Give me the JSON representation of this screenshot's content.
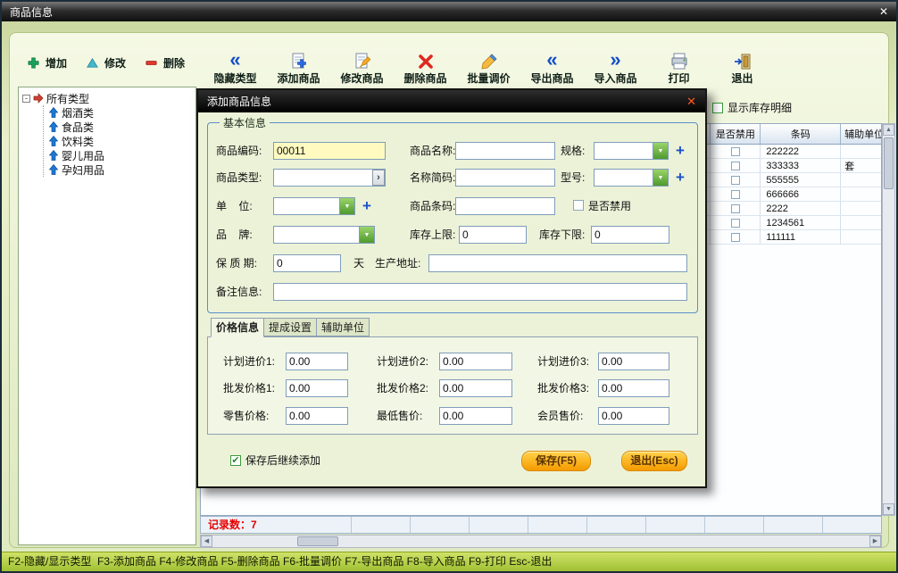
{
  "window": {
    "title": "商品信息",
    "close_glyph": "✕"
  },
  "toolbar": {
    "small": [
      {
        "label": "增加"
      },
      {
        "label": "修改"
      },
      {
        "label": "删除"
      }
    ],
    "large": [
      {
        "label": "隐藏类型"
      },
      {
        "label": "添加商品"
      },
      {
        "label": "修改商品"
      },
      {
        "label": "删除商品"
      },
      {
        "label": "批量调价"
      },
      {
        "label": "导出商品"
      },
      {
        "label": "导入商品"
      },
      {
        "label": "打印"
      },
      {
        "label": "退出"
      }
    ]
  },
  "tree": {
    "root": "所有类型",
    "expand_glyph": "-",
    "items": [
      {
        "label": "烟酒类"
      },
      {
        "label": "食品类"
      },
      {
        "label": "饮料类"
      },
      {
        "label": "婴儿用品"
      },
      {
        "label": "孕妇用品"
      }
    ]
  },
  "inventory": {
    "show_detail_label": "显示库存明细",
    "headers": [
      "是否禁用",
      "条码",
      "辅助单位"
    ],
    "rows": [
      {
        "barcode": "222222",
        "aux": ""
      },
      {
        "barcode": "333333",
        "aux": "套"
      },
      {
        "barcode": "555555",
        "aux": ""
      },
      {
        "barcode": "666666",
        "aux": ""
      },
      {
        "barcode": "2222",
        "aux": ""
      },
      {
        "barcode": "1234561",
        "aux": ""
      },
      {
        "barcode": "111111",
        "aux": ""
      }
    ],
    "record_label": "记录数：",
    "record_count": "7"
  },
  "dialog": {
    "title": "添加商品信息",
    "close_glyph": "✕",
    "group_title": "基本信息",
    "fields": {
      "code_label": "商品编码:",
      "code_value": "00011",
      "name_label": "商品名称:",
      "spec_label": "规格:",
      "type_label": "商品类型:",
      "short_label": "名称简码:",
      "model_label": "型号:",
      "unit_label": "单    位:",
      "barcode_label": "商品条码:",
      "disable_label": "是否禁用",
      "brand_label": "品    牌:",
      "stock_max_label": "库存上限:",
      "stock_max_value": "0",
      "stock_min_label": "库存下限:",
      "stock_min_value": "0",
      "shelf_label": "保 质 期:",
      "shelf_value": "0",
      "shelf_suffix": "天",
      "addr_label": "生产地址:",
      "remark_label": "备注信息:"
    },
    "tabs": [
      {
        "label": "价格信息"
      },
      {
        "label": "提成设置"
      },
      {
        "label": "辅助单位"
      }
    ],
    "prices": [
      {
        "label": "计划进价1:",
        "value": "0.00"
      },
      {
        "label": "计划进价2:",
        "value": "0.00"
      },
      {
        "label": "计划进价3:",
        "value": "0.00"
      },
      {
        "label": "批发价格1:",
        "value": "0.00"
      },
      {
        "label": "批发价格2:",
        "value": "0.00"
      },
      {
        "label": "批发价格3:",
        "value": "0.00"
      },
      {
        "label": "零售价格:",
        "value": "0.00"
      },
      {
        "label": "最低售价:",
        "value": "0.00"
      },
      {
        "label": "会员售价:",
        "value": "0.00"
      }
    ],
    "continue_label": "保存后继续添加",
    "save_label": "保存(F5)",
    "exit_label": "退出(Esc)"
  },
  "statusbar": {
    "text": "F2-隐藏/显示类型  F3-添加商品 F4-修改商品 F5-删除商品 F6-批量调价 F7-导出商品 F8-导入商品 F9-打印 Esc-退出"
  }
}
